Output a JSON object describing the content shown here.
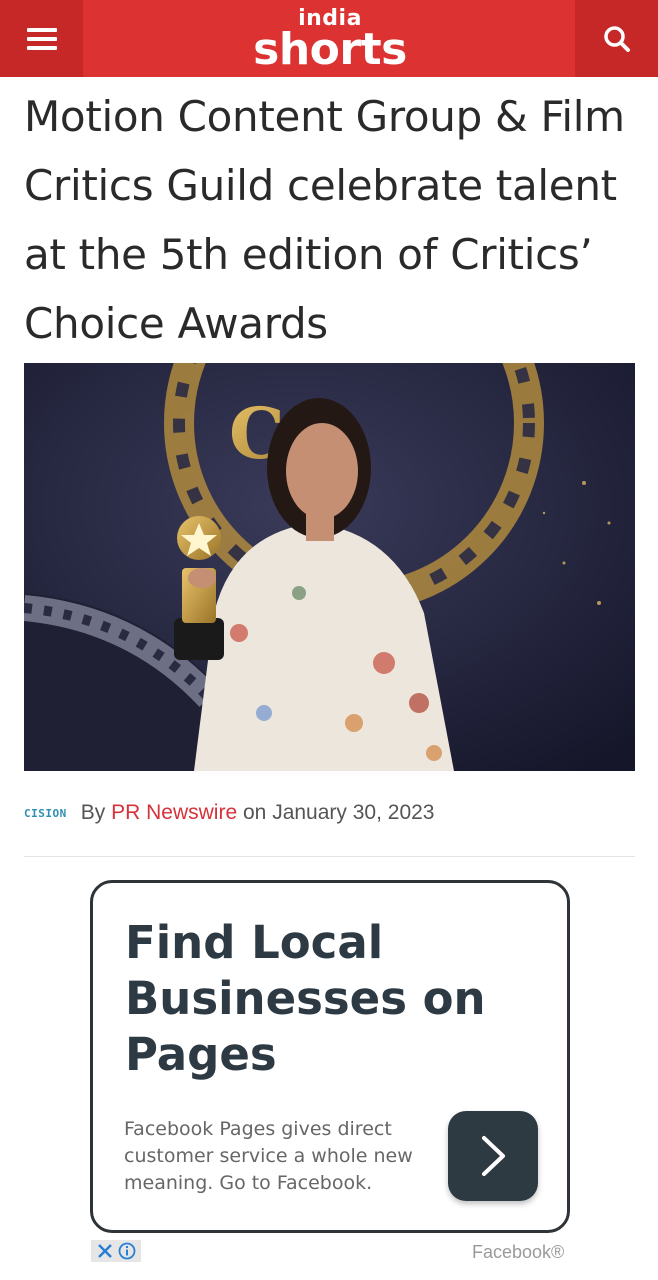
{
  "header": {
    "logo_top": "india",
    "logo_bottom": "shorts",
    "menu_icon": "hamburger-menu-icon",
    "search_icon": "search-icon",
    "colors": {
      "brand": "#dc3232",
      "brand_dark": "#c62828"
    }
  },
  "article": {
    "title": "Motion Content Group & Film Critics Guild celebrate talent at the 5th edition of Critics’ Choice Awards",
    "byline": {
      "source_logo": "CISION",
      "by": "By",
      "author": "PR Newswire",
      "on": "on",
      "date": "January 30, 2023"
    }
  },
  "ad": {
    "headline": "Find Local Businesses on Pages",
    "body": "Facebook Pages gives direct customer service a whole new meaning. Go to Facebook.",
    "cta_icon": "chevron-right-icon",
    "sponsor": "Facebook®",
    "adchoices_icons": [
      "close-icon",
      "info-icon"
    ]
  }
}
